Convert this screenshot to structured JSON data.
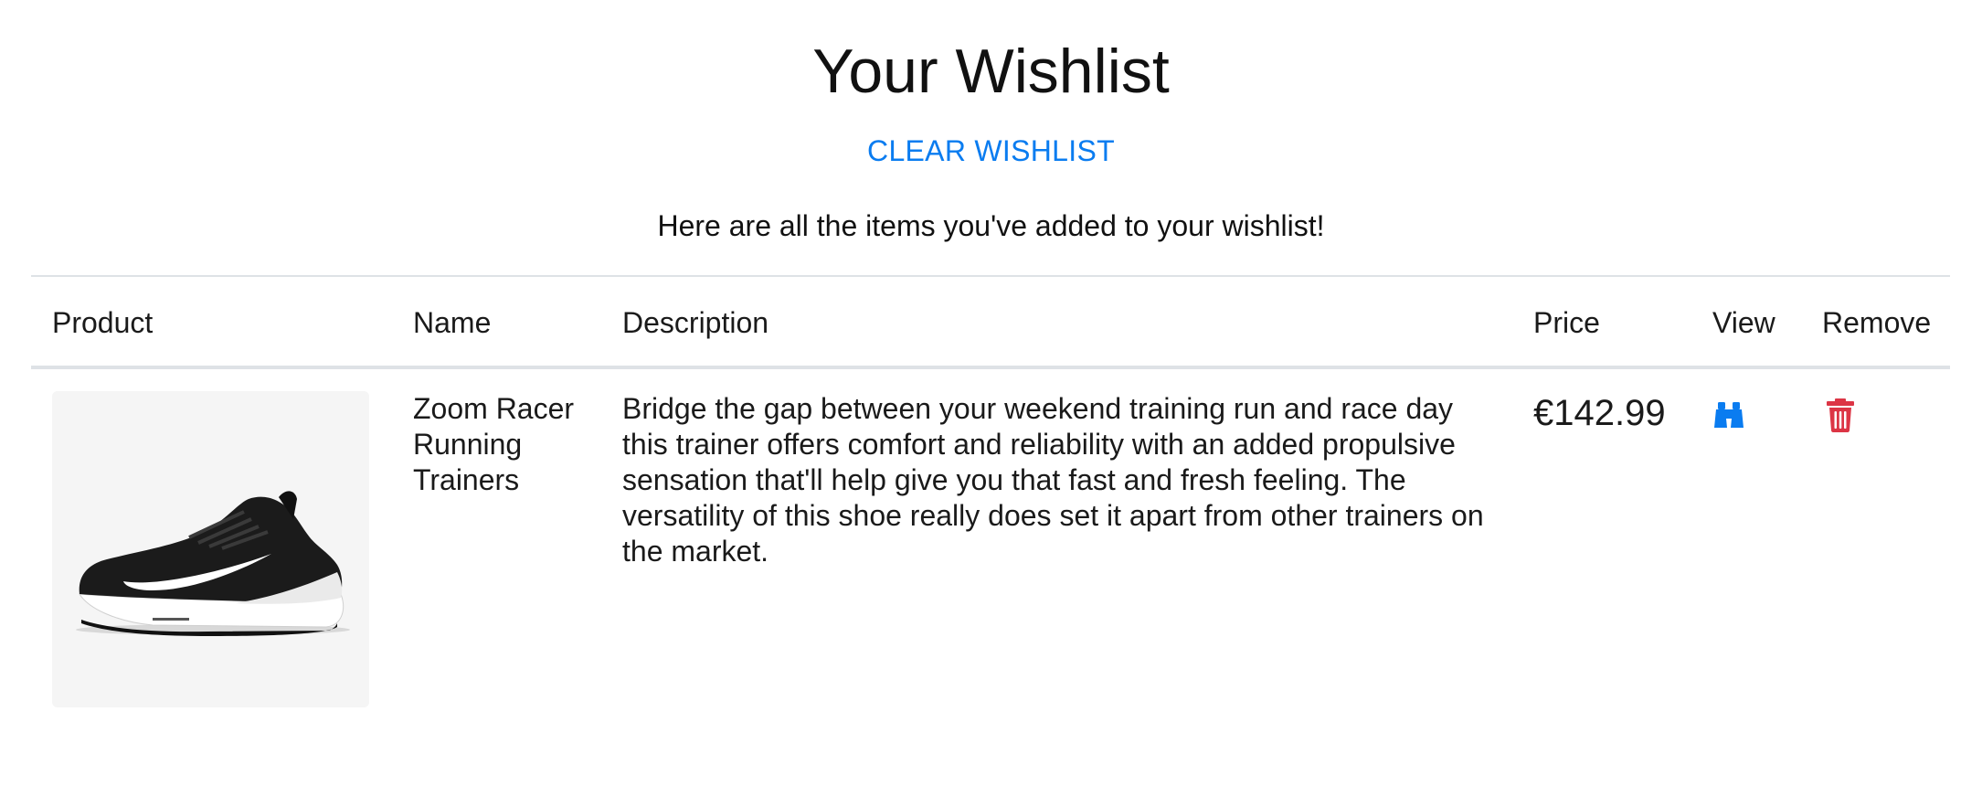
{
  "header": {
    "title": "Your Wishlist",
    "clear_label": "CLEAR WISHLIST",
    "subtitle": "Here are all the items you've added to your wishlist!"
  },
  "table": {
    "columns": [
      "Product",
      "Name",
      "Description",
      "Price",
      "View",
      "Remove"
    ],
    "rows": [
      {
        "image": "running-shoe-image",
        "name": "Zoom Racer Running Trainers",
        "description": "Bridge the gap between your weekend training run and race day this trainer offers comfort and reliability with an added propulsive sensation that'll help give you that fast and fresh feeling. The versatility of this shoe really does set it apart from other trainers on the market.",
        "price": "€142.99",
        "view_icon": "binoculars-icon",
        "remove_icon": "trash-icon"
      }
    ]
  },
  "colors": {
    "link": "#0a7cf0",
    "view_icon": "#0a7cf0",
    "remove_icon": "#dc3545",
    "divider": "#dee2e6",
    "card_bg": "#f5f5f5"
  }
}
